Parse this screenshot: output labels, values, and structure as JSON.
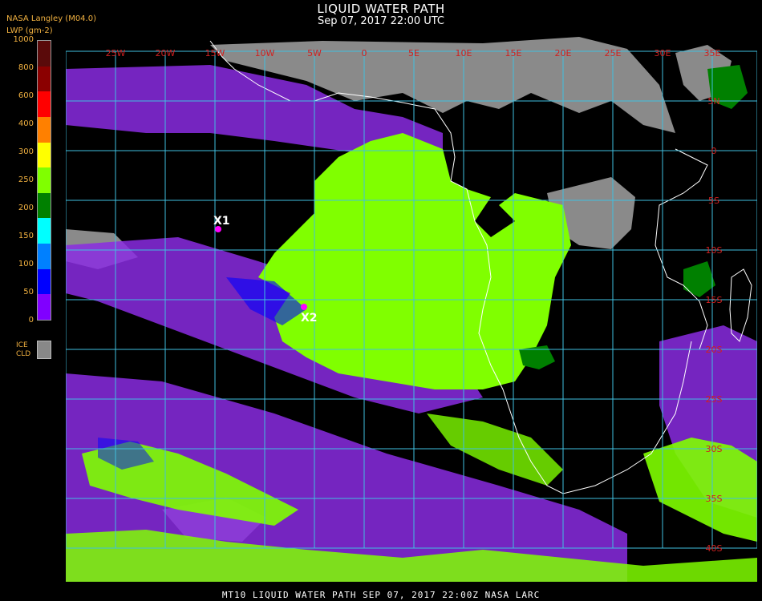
{
  "header": {
    "title": "LIQUID WATER PATH",
    "datetime": "Sep 07, 2017 22:00 UTC",
    "producer": "NASA Langley (M04.0)",
    "units": "LWP (gm-2)"
  },
  "legend": {
    "ticks": [
      "1000",
      "800",
      "600",
      "400",
      "300",
      "250",
      "200",
      "150",
      "100",
      "50",
      "0"
    ],
    "colors": [
      "#5a0a0a",
      "#8b0000",
      "#ff0000",
      "#ff8000",
      "#ffff00",
      "#80ff00",
      "#008000",
      "#00ffff",
      "#0080ff",
      "#0000ff",
      "#8000ff"
    ],
    "ice_label_1": "ICE",
    "ice_label_2": "CLD",
    "ice_color": "#888888"
  },
  "map": {
    "lon_labels": [
      "25W",
      "20W",
      "15W",
      "10W",
      "5W",
      "0",
      "5E",
      "10E",
      "15E",
      "20E",
      "25E",
      "30E",
      "35E"
    ],
    "lat_labels": [
      "5N",
      "0",
      "5S",
      "10S",
      "15S",
      "20S",
      "25S",
      "30S",
      "35S",
      "40S"
    ],
    "markers": [
      {
        "label": "X1",
        "color": "#ff00ff"
      },
      {
        "label": "X2",
        "color": "#ff00ff"
      }
    ],
    "grid_color": "#40c0e0",
    "label_color": "#d02020",
    "coast_color": "#ffffff"
  },
  "footer": {
    "text": "MT10  LIQUID WATER PATH   SEP 07, 2017 22:00Z   NASA LARC"
  }
}
